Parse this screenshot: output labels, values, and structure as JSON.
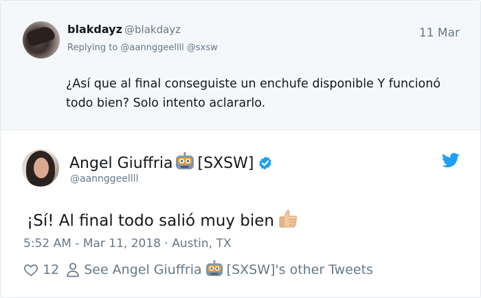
{
  "reply": {
    "name": "blakdayz",
    "handle": "@blakdayz",
    "date": "11 Mar",
    "replying_to": "Replying to @aannggeellll @sxsw",
    "text": "¿Así que al final conseguiste un enchufe disponible Y  funcionó todo bien? Solo intento aclararlo."
  },
  "tweet": {
    "name": "Angel Giuffria",
    "name_suffix": "[SXSW]",
    "handle": "@aannggeellll",
    "text": "¡Sí! Al final todo salió muy bien",
    "meta": "5:52 AM - Mar 11, 2018 · Austin, TX",
    "likes": "12",
    "see_other_prefix": "See Angel Giuffria",
    "see_other_suffix": "[SXSW]'s other Tweets",
    "icons": [
      "robot-emoji",
      "verified-badge",
      "twitter-bird",
      "thumbs-up-emoji",
      "heart-icon",
      "person-icon"
    ],
    "colors": {
      "accent": "#1da1f2",
      "text": "#14171a",
      "muted": "#657786"
    }
  }
}
